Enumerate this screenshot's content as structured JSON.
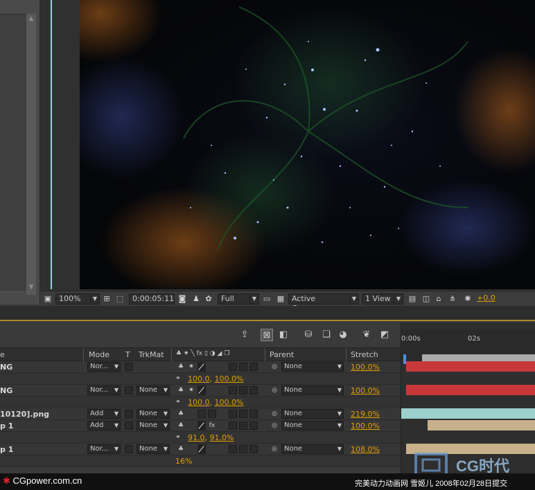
{
  "viewer_toolbar": {
    "magnification": "100%",
    "timecode": "0:00:05:11",
    "resolution": "Full",
    "camera": "Active Camera",
    "views": "1 View",
    "exposure": "+0.0"
  },
  "timeline": {
    "columns": {
      "source": "e",
      "mode": "Mode",
      "t": "T",
      "trkmat": "TrkMat",
      "parent": "Parent",
      "stretch": "Stretch"
    },
    "ruler": {
      "start": "0:00s",
      "mark": "02s"
    },
    "layers": [
      {
        "name": "NG",
        "mode": "Nor...",
        "trkmat": "",
        "parent": "None",
        "stretch": "100.0%",
        "bar_color": "#c8383a"
      },
      {
        "name": "NG",
        "mode": "Nor...",
        "trkmat": "None",
        "parent": "None",
        "stretch": "100.0%",
        "bar_color": "#c8383a"
      },
      {
        "name": "10120].png",
        "mode": "Add",
        "trkmat": "None",
        "parent": "None",
        "stretch": "219.0%",
        "bar_color": "#9cd0cc"
      },
      {
        "name": "p 1",
        "mode": "Add",
        "trkmat": "None",
        "parent": "None",
        "stretch": "100.0%",
        "bar_color": "#c8b08a"
      },
      {
        "name": "p 1",
        "mode": "Nor...",
        "trkmat": "None",
        "parent": "None",
        "stretch": "108.0%",
        "bar_color": "#c8b08a"
      }
    ],
    "sub_rows": {
      "scale_1": {
        "a": "100.0",
        "b": "100.0%"
      },
      "scale_2": {
        "a": "100.0",
        "b": "100.0%"
      },
      "scale_3": {
        "a": "91.0",
        "b": "91.0%"
      },
      "opacity": "16%"
    }
  },
  "footer": {
    "left": "CGpower.com.cn",
    "right": "完美动力动画网 雪姬儿 2008年02月28日提交",
    "logo": "CG时代"
  },
  "colors": {
    "accent": "#e0a000",
    "cti": "#4a8fd8",
    "guide": "#8fd8e0"
  },
  "icons": [
    "scroll-up-icon",
    "scroll-down-icon",
    "camera-icon",
    "star-icon",
    "flower-icon",
    "grid-icon"
  ]
}
